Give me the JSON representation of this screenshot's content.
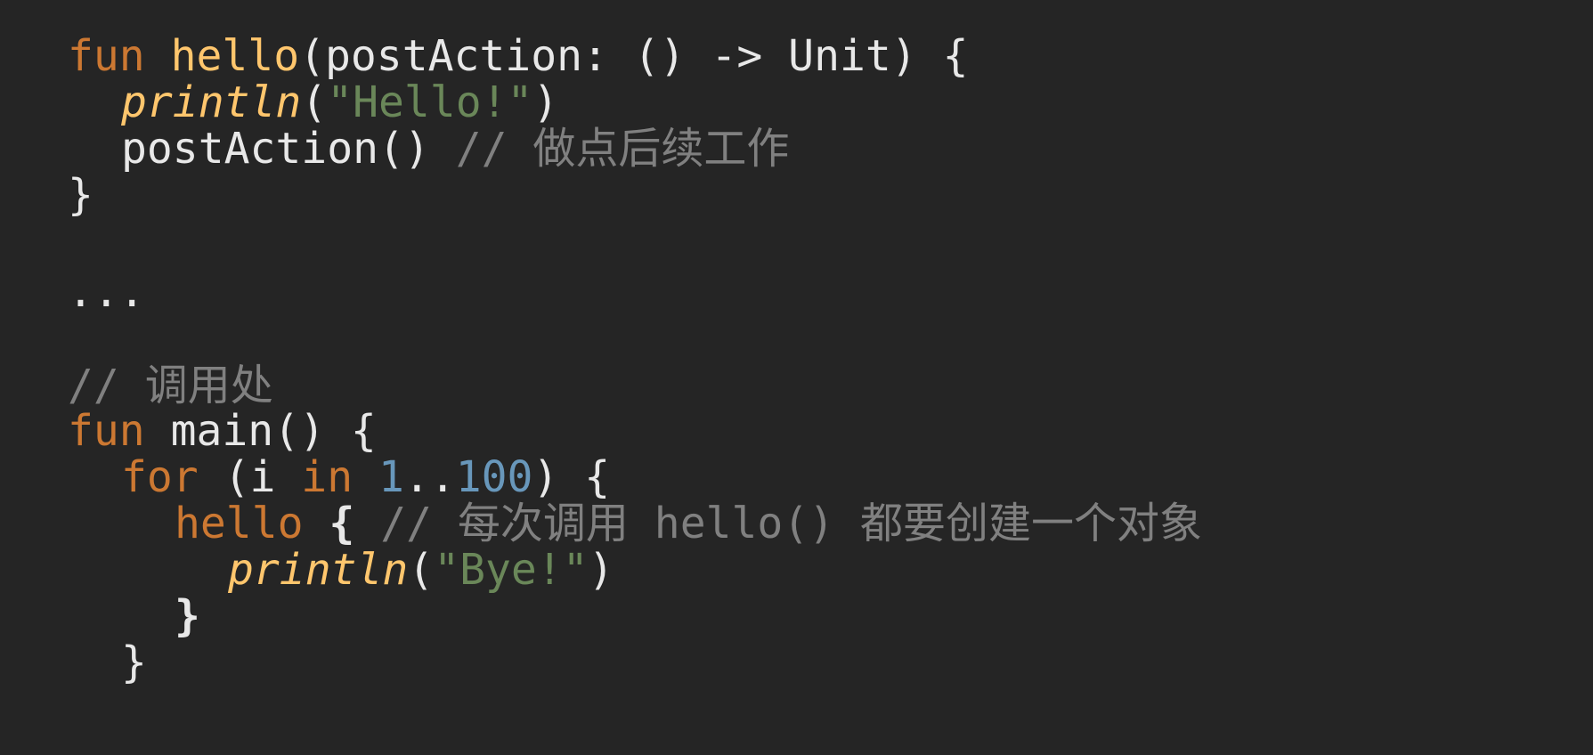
{
  "code": {
    "l1": {
      "kw_fun": "fun",
      "fn_name": "hello",
      "params": "(postAction: () -> Unit) {"
    },
    "l2": {
      "fn_println": "println",
      "paren_open": "(",
      "str": "\"Hello!\"",
      "paren_close": ")"
    },
    "l3": {
      "call": "postAction() ",
      "comment": "// 做点后续工作"
    },
    "l4": {
      "brace": "}"
    },
    "l5": {
      "ellipsis": "..."
    },
    "l6": {
      "comment": "// 调用处"
    },
    "l7": {
      "kw_fun": "fun",
      "rest": " main() {"
    },
    "l8": {
      "kw_for": "for",
      "open": " (i ",
      "kw_in": "in",
      "space": " ",
      "num_start": "1",
      "range": "..",
      "num_end": "100",
      "close": ") {"
    },
    "l9": {
      "call": "hello",
      "brace": " {",
      "comment": " // 每次调用 hello() 都要创建一个对象"
    },
    "l10": {
      "fn_println": "println",
      "paren_open": "(",
      "str": "\"Bye!\"",
      "paren_close": ")"
    },
    "l11": {
      "brace": "}"
    },
    "l12": {
      "brace": "}"
    }
  },
  "colors": {
    "background": "#252525",
    "keyword": "#cc7832",
    "function": "#ffc66d",
    "string": "#6a8759",
    "number": "#6897bb",
    "comment": "#808080",
    "text": "#e8e8e8"
  }
}
